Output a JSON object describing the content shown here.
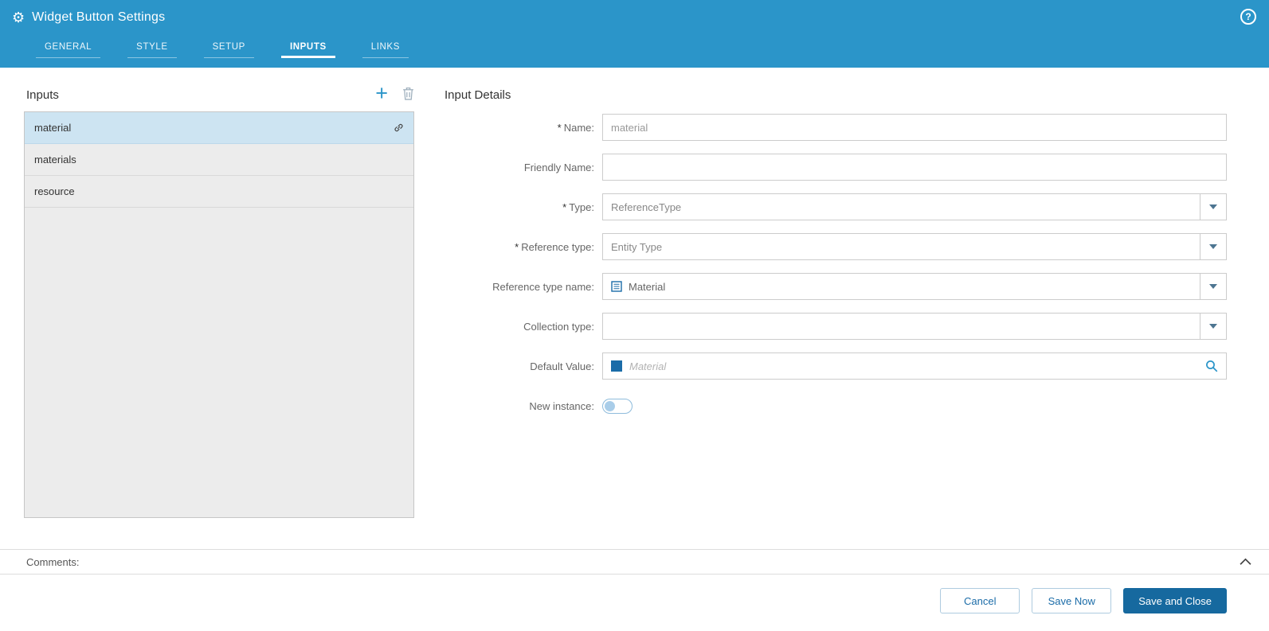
{
  "header": {
    "title": "Widget Button Settings",
    "tabs": [
      {
        "label": "GENERAL"
      },
      {
        "label": "STYLE"
      },
      {
        "label": "SETUP"
      },
      {
        "label": "INPUTS"
      },
      {
        "label": "LINKS"
      }
    ],
    "active_tab": "INPUTS"
  },
  "icons": {
    "gear": "⚙",
    "help": "?",
    "add": "+",
    "trash": "trash-icon",
    "link": "link-icon",
    "caret_down": "chevron-down-icon",
    "search": "search-icon",
    "entity_list": "entity-list-icon",
    "chevron_up": "chevron-up-icon"
  },
  "inputs_panel": {
    "title": "Inputs",
    "items": [
      {
        "label": "material",
        "selected": true,
        "linked": true
      },
      {
        "label": "materials",
        "selected": false,
        "linked": false
      },
      {
        "label": "resource",
        "selected": false,
        "linked": false
      }
    ]
  },
  "details": {
    "title": "Input Details",
    "required_marker": "*",
    "name": {
      "label": "Name:",
      "value": "material",
      "required": true
    },
    "friendly_name": {
      "label": "Friendly Name:",
      "value": "",
      "required": false
    },
    "type": {
      "label": "Type:",
      "value": "ReferenceType",
      "required": true
    },
    "reference_type": {
      "label": "Reference type:",
      "value": "Entity Type",
      "required": true
    },
    "reference_type_name": {
      "label": "Reference type name:",
      "value": "Material",
      "required": false
    },
    "collection_type": {
      "label": "Collection type:",
      "value": "",
      "required": false
    },
    "default_value": {
      "label": "Default Value:",
      "value": "",
      "placeholder": "Material",
      "required": false
    },
    "new_instance": {
      "label": "New instance:",
      "state": "off",
      "required": false
    }
  },
  "comments": {
    "label": "Comments:"
  },
  "footer": {
    "cancel_label": "Cancel",
    "save_now_label": "Save Now",
    "save_and_close_label": "Save and Close"
  },
  "colors": {
    "header_bg": "#2b95c9",
    "primary_button_bg": "#16699f",
    "selected_item_bg": "#cde4f2",
    "entity_square": "#1b6ca8"
  }
}
